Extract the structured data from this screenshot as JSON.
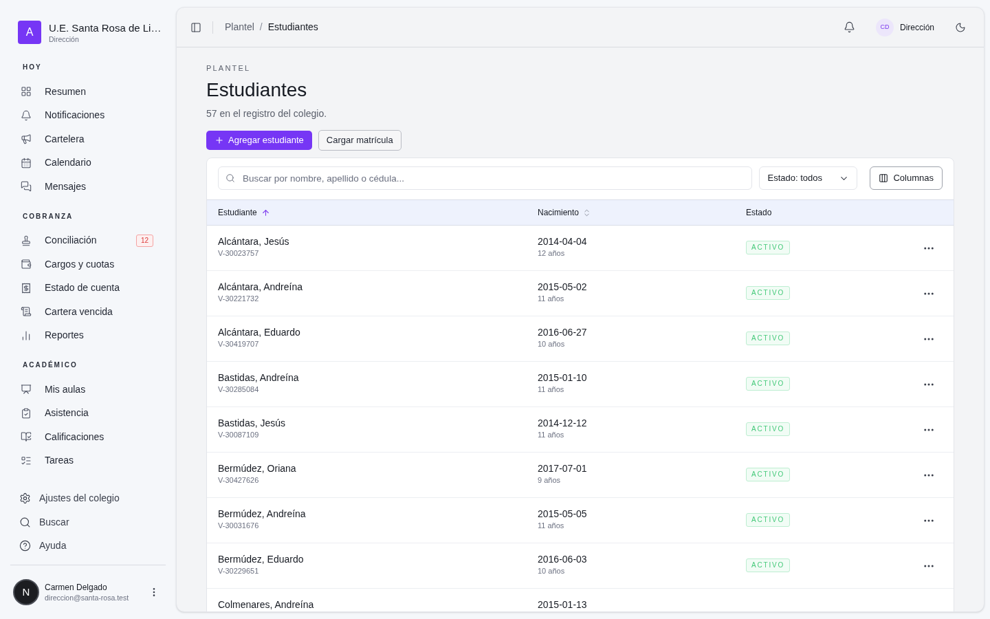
{
  "sidebar": {
    "brand": {
      "initial": "A",
      "name": "U.E. Santa Rosa de Li…",
      "role": "Dirección"
    },
    "sections": [
      {
        "title": "HOY",
        "items": [
          {
            "label": "Resumen"
          },
          {
            "label": "Notificaciones"
          },
          {
            "label": "Cartelera"
          },
          {
            "label": "Calendario"
          },
          {
            "label": "Mensajes"
          }
        ]
      },
      {
        "title": "COBRANZA",
        "items": [
          {
            "label": "Conciliación",
            "badge": "12"
          },
          {
            "label": "Cargos y cuotas"
          },
          {
            "label": "Estado de cuenta"
          },
          {
            "label": "Cartera vencida"
          },
          {
            "label": "Reportes"
          }
        ]
      },
      {
        "title": "ACADÉMICO",
        "items": [
          {
            "label": "Mis aulas"
          },
          {
            "label": "Asistencia"
          },
          {
            "label": "Calificaciones"
          },
          {
            "label": "Tareas"
          }
        ]
      }
    ],
    "footer_items": [
      {
        "label": "Ajustes del colegio"
      },
      {
        "label": "Buscar"
      },
      {
        "label": "Ayuda"
      }
    ],
    "user": {
      "initial": "N",
      "name": "Carmen Delgado",
      "email": "direccion@santa-rosa.test"
    }
  },
  "header": {
    "breadcrumb": [
      "Plantel",
      "Estudiantes"
    ],
    "separator": "/",
    "user": {
      "initials": "CD",
      "role": "Dirección"
    }
  },
  "page": {
    "eyebrow": "PLANTEL",
    "title": "Estudiantes",
    "subtitle": "57 en el registro del colegio.",
    "actions": [
      {
        "label": "Agregar estudiante",
        "kind": "primary"
      },
      {
        "label": "Cargar matrícula",
        "kind": "secondary"
      }
    ]
  },
  "table": {
    "search": {
      "placeholder": "Buscar por nombre, apellido o cédula..."
    },
    "filter": "Estado: todos",
    "columns_button": "Columnas",
    "columns": [
      {
        "label": "Estudiante",
        "sorted": true
      },
      {
        "label": "Nacimiento",
        "sorted": false
      },
      {
        "label": "Estado"
      }
    ],
    "rows": [
      {
        "name": "Alcántara, Jesús",
        "id": "V-30023757",
        "birth": "2014-04-04",
        "age": "12 años",
        "status": "ACTIVO"
      },
      {
        "name": "Alcántara, Andreína",
        "id": "V-30221732",
        "birth": "2015-05-02",
        "age": "11 años",
        "status": "ACTIVO"
      },
      {
        "name": "Alcántara, Eduardo",
        "id": "V-30419707",
        "birth": "2016-06-27",
        "age": "10 años",
        "status": "ACTIVO"
      },
      {
        "name": "Bastidas, Andreína",
        "id": "V-30285084",
        "birth": "2015-01-10",
        "age": "11 años",
        "status": "ACTIVO"
      },
      {
        "name": "Bastidas, Jesús",
        "id": "V-30087109",
        "birth": "2014-12-12",
        "age": "11 años",
        "status": "ACTIVO"
      },
      {
        "name": "Bermúdez, Oriana",
        "id": "V-30427626",
        "birth": "2017-07-01",
        "age": "9 años",
        "status": "ACTIVO"
      },
      {
        "name": "Bermúdez, Andreína",
        "id": "V-30031676",
        "birth": "2015-05-05",
        "age": "11 años",
        "status": "ACTIVO"
      },
      {
        "name": "Bermúdez, Eduardo",
        "id": "V-30229651",
        "birth": "2016-06-03",
        "age": "10 años",
        "status": "ACTIVO"
      },
      {
        "name": "Colmenares, Andreína",
        "birth": "2015-01-13"
      }
    ]
  }
}
